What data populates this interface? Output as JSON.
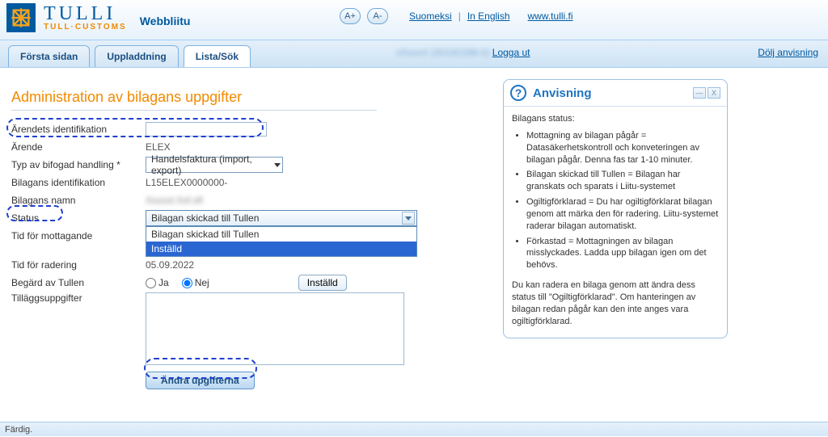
{
  "brand": {
    "name_big": "TULLI",
    "name_small": "TULL·CUSTOMS",
    "app": "Webbliitu"
  },
  "font_buttons": {
    "inc": "A+",
    "dec": "A-"
  },
  "header_links": {
    "suomeksi": "Suomeksi",
    "english": "In English",
    "site": "www.tulli.fi"
  },
  "tabs": {
    "t0": "Första sidan",
    "t1": "Uppladdning",
    "t2": "Lista/Sök"
  },
  "userbar": {
    "user_prefix": "xXxxxX",
    "user_paren": "(00192298-0)",
    "logout": "Logga ut",
    "hide": "Dölj anvisning"
  },
  "page_title": "Administration av bilagans uppgifter",
  "form": {
    "l_case_id": "Ärendets identifikation",
    "v_case_id": "",
    "l_case": "Ärende",
    "v_case": "ELEX",
    "l_doctype": "Typ av bifogad handling *",
    "v_doctype": "Handelsfaktura (import, export)",
    "l_att_id": "Bilagans identifikation",
    "v_att_id": "L15ELEX0000000-",
    "l_att_name": "Bilagans namn",
    "v_att_name": "Xxxxxl.Xxf.xfl",
    "l_status": "Status",
    "v_status": "Bilagan skickad till Tullen",
    "status_opts": {
      "o0": "Bilagan skickad till Tullen",
      "o1": "Inställd"
    },
    "l_recv_time": "Tid för mottagande",
    "v_recv_time": "",
    "l_del_time": "Tid för radering",
    "v_del_time": "05.09.2022",
    "l_requested": "Begärd av Tullen",
    "r_yes": "Ja",
    "r_no": "Nej",
    "btn_cancel": "Inställd",
    "l_extra": "Tilläggsuppgifter",
    "btn_submit": "Ändra upgifterna"
  },
  "side": {
    "title": "Anvisning",
    "status_label": "Bilagans status:",
    "b1": "Mottagning av bilagan pågår = Datasäkerhetskontroll och konveteringen av bilagan pågår. Denna fas tar 1-10 minuter.",
    "b2": "Bilagan skickad till Tullen = Bilagan har granskats och sparats i Liitu-systemet",
    "b3": "Ogiltigförklarad = Du har ogiltigförklarat bilagan genom att märka den för radering. Liitu-systemet raderar bilagan automatiskt.",
    "b4": "Förkastad = Mottagningen av bilagan misslyckades. Ladda upp bilagan igen om det behövs.",
    "para": "Du kan radera en bilaga genom att ändra dess status till \"Ogiltigförklarad\". Om hanteringen av bilagan redan pågår kan den inte anges vara ogiltigförklarad."
  },
  "statusbar": "Färdig."
}
